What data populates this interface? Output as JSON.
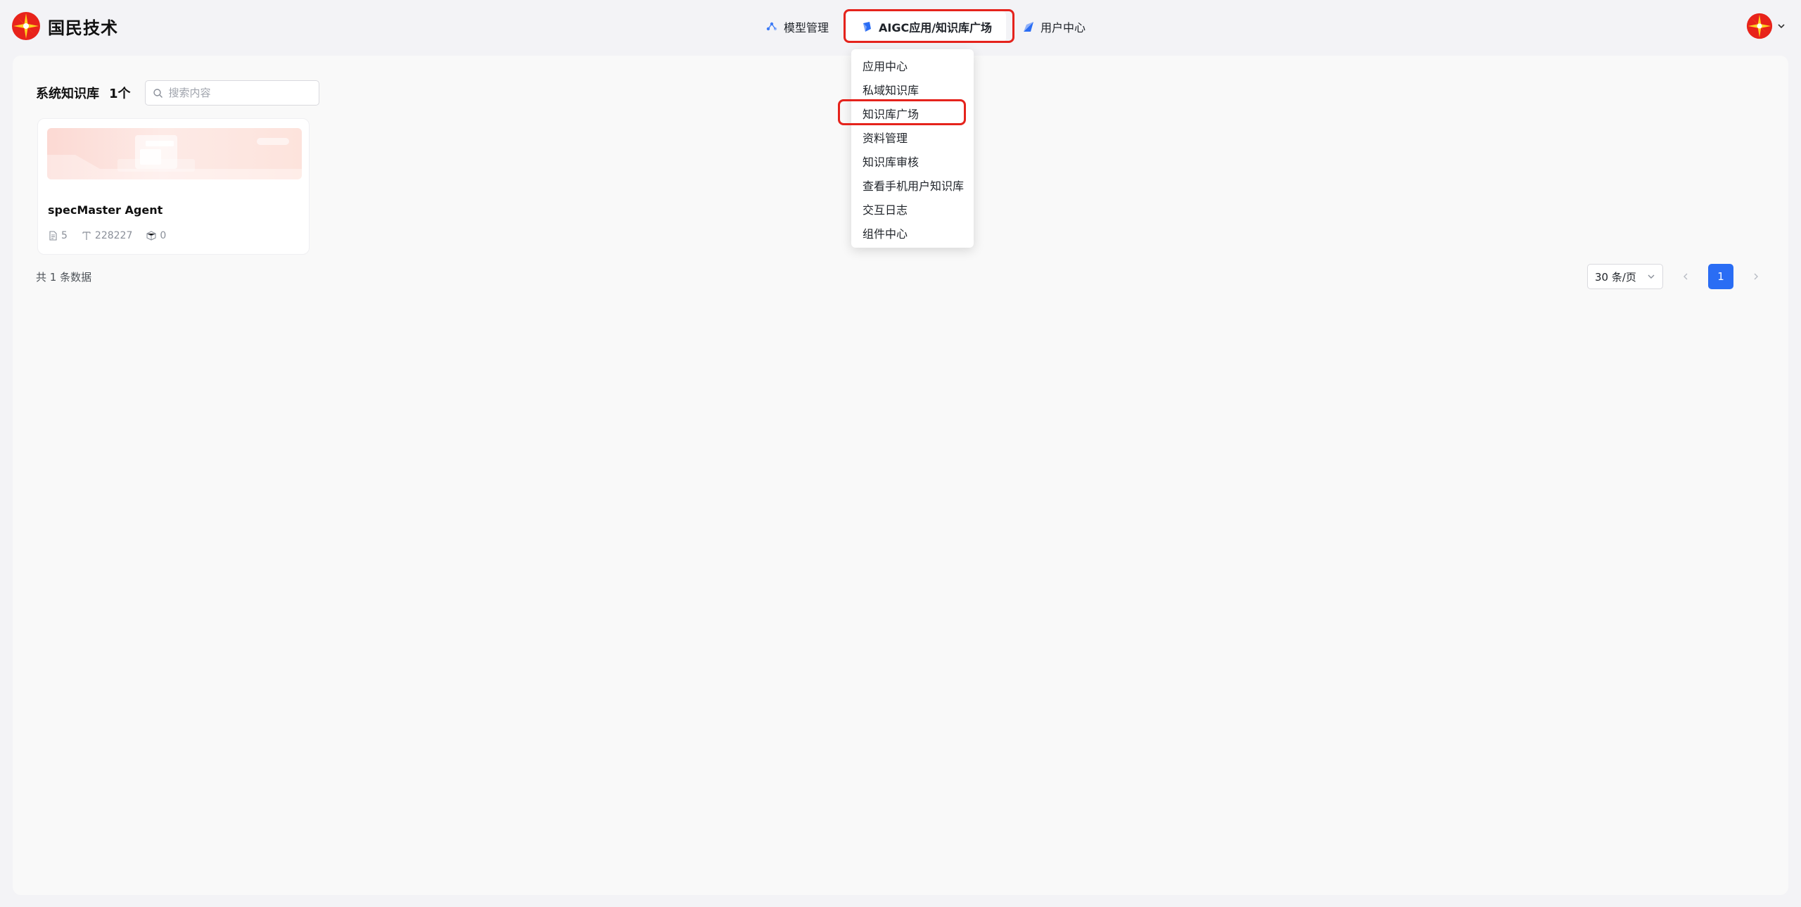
{
  "brand": {
    "name": "国民技术"
  },
  "nav": {
    "items": [
      {
        "label": "模型管理",
        "icon": "model-icon"
      },
      {
        "label": "AIGC应用/知识库广场",
        "icon": "aigc-icon"
      },
      {
        "label": "用户中心",
        "icon": "user-center-icon"
      }
    ]
  },
  "dropdown": {
    "items": [
      {
        "label": "应用中心"
      },
      {
        "label": "私域知识库"
      },
      {
        "label": "知识库广场"
      },
      {
        "label": "资料管理"
      },
      {
        "label": "知识库审核"
      },
      {
        "label": "查看手机用户知识库"
      },
      {
        "label": "交互日志"
      },
      {
        "label": "组件中心"
      }
    ]
  },
  "main": {
    "title": "系统知识库",
    "count": "1个",
    "search_placeholder": "搜索内容",
    "cards": [
      {
        "title": "specMaster Agent",
        "docs": "5",
        "chars": "228227",
        "hits": "0"
      }
    ],
    "total": "共 1 条数据",
    "pager": {
      "page_size": "30 条/页",
      "current": "1"
    }
  },
  "colors": {
    "accent": "#2a6df4",
    "highlight": "#e5231c",
    "brand": "#e5231c"
  }
}
